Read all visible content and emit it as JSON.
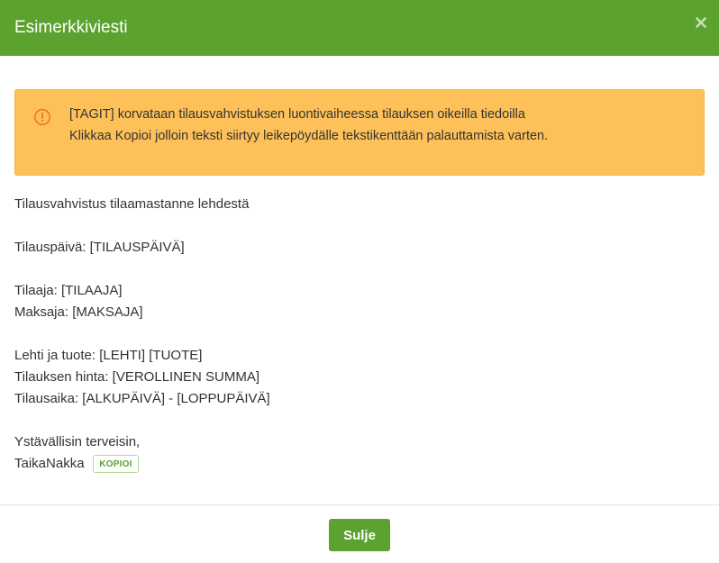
{
  "header": {
    "title": "Esimerkkiviesti",
    "close_icon": "close-icon"
  },
  "alert": {
    "icon": "info-circle-icon",
    "line1": "[TAGIT] korvataan tilausvahvistuksen luontivaiheessa tilauksen oikeilla tiedoilla",
    "line2": "Klikkaa Kopioi jolloin teksti siirtyy leikepöydälle tekstikenttään palauttamista varten."
  },
  "message": {
    "heading": "Tilausvahvistus tilaamastanne lehdestä",
    "order_date": "Tilauspäivä: [TILAUSPÄIVÄ]",
    "subscriber": "Tilaaja: [TILAAJA]",
    "payer": "Maksaja: [MAKSAJA]",
    "product": "Lehti ja tuote: [LEHTI] [TUOTE]",
    "price": "Tilauksen hinta: [VEROLLINEN SUMMA]",
    "period": "Tilausaika: [ALKUPÄIVÄ] - [LOPPUPÄIVÄ]",
    "greeting": "Ystävällisin terveisin,",
    "signature": "TaikaNakka"
  },
  "copy_label": "KOPIOI",
  "footer": {
    "close_label": "Sulje"
  },
  "colors": {
    "header_green": "#5ba22e",
    "alert_orange": "#fec159",
    "icon_orange": "#e8762b",
    "text": "#333333"
  }
}
